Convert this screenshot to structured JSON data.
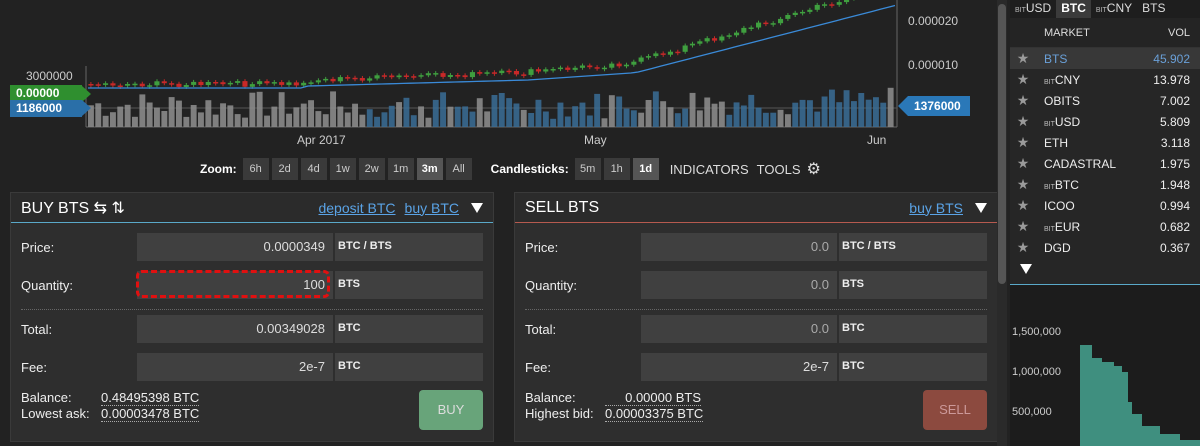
{
  "chart": {
    "y_ticks_right": [
      "0.000020",
      "0.000010"
    ],
    "y_tick_left": "3000000",
    "x_ticks": [
      "Apr 2017",
      "May",
      "Jun"
    ],
    "tag_price_left": "0.00000",
    "tag_volume_left": "1186000",
    "tag_volume_right": "1376000",
    "colors": {
      "up": "#3f9f3f",
      "down": "#c82828",
      "volume": "#3a6d96",
      "ma_line": "#3a8ad8"
    }
  },
  "zoom": {
    "label": "Zoom:",
    "options": [
      "6h",
      "2d",
      "4d",
      "1w",
      "2w",
      "1m",
      "3m",
      "All"
    ],
    "active": "3m"
  },
  "candlesticks": {
    "label": "Candlesticks:",
    "options": [
      "5m",
      "1h",
      "1d"
    ],
    "active": "1d"
  },
  "toolbar": {
    "indicators": "INDICATORS",
    "tools": "TOOLS",
    "settings_icon": "gear-icon"
  },
  "buy": {
    "title": "BUY BTS ⇆ ⇅",
    "link_deposit": "deposit BTC",
    "link_buy": "buy BTC",
    "price_label": "Price:",
    "price_value": "0.0000349",
    "price_unit": "BTC / BTS",
    "qty_label": "Quantity:",
    "qty_value": "100",
    "qty_unit": "BTS",
    "total_label": "Total:",
    "total_value": "0.00349028",
    "total_unit": "BTC",
    "fee_label": "Fee:",
    "fee_value": "2e-7",
    "fee_unit": "BTC",
    "balance_label": "Balance:",
    "balance_value": "0.48495398 BTC",
    "lowest_label": "Lowest ask:",
    "lowest_value": "0.00003478 BTC",
    "button": "BUY"
  },
  "sell": {
    "title": "SELL BTS",
    "link_buy": "buy BTS",
    "price_label": "Price:",
    "price_value": "0.0",
    "price_unit": "BTC / BTS",
    "qty_label": "Quantity:",
    "qty_value": "0.0",
    "qty_unit": "BTS",
    "total_label": "Total:",
    "total_value": "0.0",
    "total_unit": "BTC",
    "fee_label": "Fee:",
    "fee_value": "2e-7",
    "fee_unit": "BTC",
    "balance_label": "Balance:",
    "balance_value": "0.00000 BTS",
    "highest_label": "Highest bid:",
    "highest_value": "0.00003375 BTC",
    "button": "SELL"
  },
  "markets": {
    "tabs": [
      {
        "prefix": "BIT",
        "name": "USD",
        "active": false
      },
      {
        "prefix": "",
        "name": "BTC",
        "active": true
      },
      {
        "prefix": "BIT",
        "name": "CNY",
        "active": false
      },
      {
        "prefix": "",
        "name": "BTS",
        "active": false
      }
    ],
    "col_market": "MARKET",
    "col_vol": "VOL",
    "rows": [
      {
        "prefix": "",
        "name": "BTS",
        "vol": "45.902",
        "selected": true
      },
      {
        "prefix": "BIT",
        "name": "CNY",
        "vol": "13.978",
        "selected": false
      },
      {
        "prefix": "",
        "name": "OBITS",
        "vol": "7.002",
        "selected": false
      },
      {
        "prefix": "BIT",
        "name": "USD",
        "vol": "5.809",
        "selected": false
      },
      {
        "prefix": "",
        "name": "ETH",
        "vol": "3.118",
        "selected": false
      },
      {
        "prefix": "",
        "name": "CADASTRAL",
        "vol": "1.975",
        "selected": false
      },
      {
        "prefix": "BIT",
        "name": "BTC",
        "vol": "1.948",
        "selected": false
      },
      {
        "prefix": "",
        "name": "ICOO",
        "vol": "0.994",
        "selected": false
      },
      {
        "prefix": "BIT",
        "name": "EUR",
        "vol": "0.682",
        "selected": false
      },
      {
        "prefix": "",
        "name": "DGD",
        "vol": "0.367",
        "selected": false
      }
    ]
  },
  "depth": {
    "y_ticks": [
      "1,500,000",
      "1,000,000",
      "500,000"
    ],
    "color": "#3f8f7f"
  }
}
